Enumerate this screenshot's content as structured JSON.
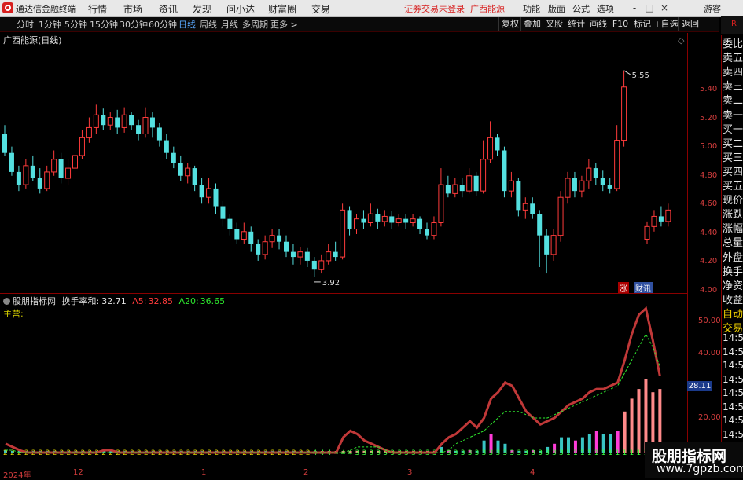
{
  "app": {
    "name": "通达信金融终端"
  },
  "menu": [
    "行情",
    "市场",
    "资讯",
    "发现",
    "问小达",
    "财富圈",
    "交易"
  ],
  "status_text": "证券交易未登录",
  "stock_name_top": "广西能源",
  "right_menu": [
    "功能",
    "版面",
    "公式",
    "选项"
  ],
  "guest_label": "游客",
  "window_controls": [
    "-",
    "□",
    "×"
  ],
  "period_tabs": [
    "分时",
    "1分钟",
    "5分钟",
    "15分钟",
    "30分钟",
    "60分钟",
    "日线",
    "周线",
    "月线",
    "多周期",
    "更多 >"
  ],
  "active_tab": "日线",
  "toolbar_buttons": [
    "复权",
    "叠加",
    "叉股",
    "统计",
    "画线",
    "F10",
    "标记",
    "+自选",
    "返回"
  ],
  "chart_title": "广西能源(日线)",
  "price_axis": [
    "5.40",
    "5.20",
    "5.00",
    "4.80",
    "4.60",
    "4.40",
    "4.20",
    "4.00"
  ],
  "high_label": "5.55",
  "low_label": "3.92",
  "badges": {
    "zhang": "涨",
    "caixun": "财讯"
  },
  "indicator": {
    "name": "股朋指标网",
    "turnover_label": "换手率和:",
    "turnover_value": "32.71",
    "a5_label": "A5:",
    "a5_value": "32.85",
    "a20_label": "A20:",
    "a20_value": "36.65",
    "main_label": "主营:",
    "axis": [
      "50.00",
      "40.00",
      "20.00"
    ],
    "current_value": "28.11",
    "colors": {
      "turnover": "#e6e6e6",
      "a5": "#ff3b3b",
      "a20": "#2ee82e",
      "main": "#d6d000"
    }
  },
  "right_panel": [
    "委比",
    "卖五",
    "卖四",
    "卖三",
    "卖二",
    "卖一",
    "买一",
    "买二",
    "买三",
    "买四",
    "买五",
    "现价",
    "涨跌",
    "涨幅",
    "总量",
    "外盘",
    "换手",
    "净资",
    "收益",
    "自动",
    "交易"
  ],
  "right_panel_times": [
    "14:5",
    "14:5",
    "14:5",
    "14:5",
    "14:5",
    "14:5",
    "14:5",
    "14:5"
  ],
  "r_mark": "R",
  "date_axis": [
    "2024年",
    "12",
    "1",
    "2",
    "3",
    "4"
  ],
  "watermark": {
    "title": "股朋指标网",
    "url": "www.7gpzb.com"
  },
  "chart_data": {
    "type": "candlestick",
    "title": "广西能源(日线)",
    "ylim": [
      3.85,
      5.6
    ],
    "candles": [
      [
        5.05,
        4.9,
        5.12,
        4.88
      ],
      [
        4.9,
        4.75,
        4.95,
        4.72
      ],
      [
        4.75,
        4.65,
        4.8,
        4.6
      ],
      [
        4.65,
        4.8,
        4.85,
        4.62
      ],
      [
        4.8,
        4.7,
        4.88,
        4.68
      ],
      [
        4.7,
        4.62,
        4.78,
        4.58
      ],
      [
        4.62,
        4.75,
        4.8,
        4.6
      ],
      [
        4.75,
        4.85,
        4.92,
        4.72
      ],
      [
        4.85,
        4.7,
        4.9,
        4.66
      ],
      [
        4.7,
        4.78,
        4.85,
        4.65
      ],
      [
        4.78,
        4.88,
        4.95,
        4.75
      ],
      [
        4.88,
        5.02,
        5.08,
        4.85
      ],
      [
        5.02,
        5.1,
        5.18,
        4.98
      ],
      [
        5.1,
        5.2,
        5.28,
        5.05
      ],
      [
        5.2,
        5.12,
        5.25,
        5.08
      ],
      [
        5.12,
        5.18,
        5.22,
        5.08
      ],
      [
        5.18,
        5.1,
        5.24,
        5.05
      ],
      [
        5.1,
        5.2,
        5.26,
        5.06
      ],
      [
        5.2,
        5.12,
        5.22,
        5.08
      ],
      [
        5.12,
        5.05,
        5.16,
        5.0
      ],
      [
        5.05,
        5.18,
        5.26,
        5.02
      ],
      [
        5.18,
        5.1,
        5.22,
        5.02
      ],
      [
        5.1,
        5.0,
        5.14,
        4.95
      ],
      [
        5.0,
        4.9,
        5.05,
        4.85
      ],
      [
        4.9,
        4.82,
        4.95,
        4.78
      ],
      [
        4.82,
        4.72,
        4.88,
        4.68
      ],
      [
        4.72,
        4.78,
        4.82,
        4.66
      ],
      [
        4.78,
        4.65,
        4.8,
        4.6
      ],
      [
        4.65,
        4.55,
        4.7,
        4.5
      ],
      [
        4.55,
        4.62,
        4.7,
        4.5
      ],
      [
        4.62,
        4.48,
        4.66,
        4.42
      ],
      [
        4.48,
        4.38,
        4.52,
        4.32
      ],
      [
        4.38,
        4.3,
        4.42,
        4.25
      ],
      [
        4.3,
        4.22,
        4.35,
        4.18
      ],
      [
        4.22,
        4.28,
        4.35,
        4.18
      ],
      [
        4.28,
        4.18,
        4.32,
        4.12
      ],
      [
        4.18,
        4.1,
        4.22,
        4.05
      ],
      [
        4.1,
        4.2,
        4.25,
        4.06
      ],
      [
        4.2,
        4.25,
        4.3,
        4.15
      ],
      [
        4.25,
        4.2,
        4.3,
        4.14
      ],
      [
        4.2,
        4.12,
        4.25,
        4.08
      ],
      [
        4.12,
        4.08,
        4.18,
        4.02
      ],
      [
        4.08,
        4.12,
        4.16,
        4.02
      ],
      [
        4.12,
        4.05,
        4.15,
        4.0
      ],
      [
        4.05,
        3.98,
        4.08,
        3.92
      ],
      [
        3.98,
        4.05,
        4.1,
        3.95
      ],
      [
        4.05,
        4.12,
        4.18,
        4.02
      ],
      [
        4.12,
        4.08,
        4.2,
        4.05
      ],
      [
        4.08,
        4.45,
        4.5,
        4.06
      ],
      [
        4.45,
        4.3,
        4.48,
        4.25
      ],
      [
        4.3,
        4.38,
        4.42,
        4.26
      ],
      [
        4.38,
        4.35,
        4.45,
        4.3
      ],
      [
        4.35,
        4.42,
        4.5,
        4.32
      ],
      [
        4.42,
        4.36,
        4.46,
        4.3
      ],
      [
        4.36,
        4.4,
        4.45,
        4.32
      ],
      [
        4.4,
        4.35,
        4.44,
        4.3
      ],
      [
        4.35,
        4.38,
        4.42,
        4.32
      ],
      [
        4.38,
        4.35,
        4.42,
        4.3
      ],
      [
        4.35,
        4.38,
        4.42,
        4.32
      ],
      [
        4.38,
        4.3,
        4.4,
        4.26
      ],
      [
        4.3,
        4.25,
        4.35,
        4.22
      ],
      [
        4.25,
        4.35,
        4.4,
        4.22
      ],
      [
        4.35,
        4.65,
        4.78,
        4.32
      ],
      [
        4.65,
        4.58,
        4.72,
        4.55
      ],
      [
        4.58,
        4.65,
        4.7,
        4.55
      ],
      [
        4.65,
        4.6,
        4.7,
        4.55
      ],
      [
        4.6,
        4.72,
        4.78,
        4.58
      ],
      [
        4.72,
        4.6,
        4.75,
        4.56
      ],
      [
        4.6,
        4.85,
        5.0,
        4.58
      ],
      [
        4.85,
        5.02,
        5.15,
        4.82
      ],
      [
        5.02,
        4.92,
        5.05,
        4.88
      ],
      [
        4.92,
        4.6,
        4.95,
        4.55
      ],
      [
        4.6,
        4.68,
        4.75,
        4.55
      ],
      [
        4.68,
        4.45,
        4.7,
        4.4
      ],
      [
        4.45,
        4.5,
        4.55,
        4.38
      ],
      [
        4.5,
        4.42,
        4.55,
        4.38
      ],
      [
        4.42,
        4.25,
        4.45,
        4.0
      ],
      [
        4.25,
        4.1,
        4.3,
        3.95
      ],
      [
        4.1,
        4.25,
        4.3,
        4.05
      ],
      [
        4.25,
        4.55,
        4.6,
        4.2
      ],
      [
        4.55,
        4.7,
        4.75,
        4.5
      ],
      [
        4.7,
        4.6,
        4.75,
        4.55
      ],
      [
        4.6,
        4.68,
        4.72,
        4.55
      ],
      [
        4.68,
        4.78,
        4.85,
        4.62
      ],
      [
        4.78,
        4.7,
        4.82,
        4.65
      ],
      [
        4.7,
        4.65,
        4.76,
        4.6
      ],
      [
        4.65,
        4.62,
        4.7,
        4.58
      ],
      [
        4.62,
        5.0,
        5.12,
        4.6
      ],
      [
        5.0,
        5.42,
        5.55,
        4.95
      ],
      [
        4.22,
        4.32,
        4.36,
        4.18
      ],
      [
        4.32,
        4.4,
        4.45,
        4.28
      ],
      [
        4.4,
        4.36,
        4.48,
        4.32
      ],
      [
        4.36,
        4.45,
        4.5,
        4.32
      ]
    ],
    "turnover": [
      10,
      9,
      8,
      7,
      6,
      5,
      4,
      4,
      5,
      6,
      6,
      7,
      8,
      9,
      9,
      8,
      7,
      7,
      6,
      6,
      5,
      5,
      4,
      4,
      4,
      3,
      3,
      3,
      2,
      2,
      2,
      2,
      3,
      3,
      3,
      3,
      3,
      3,
      3,
      3,
      3,
      3,
      3,
      3,
      3,
      4,
      5,
      6,
      9,
      7,
      7,
      7,
      6,
      6,
      6,
      5,
      5,
      5,
      5,
      5,
      5,
      5,
      11,
      10,
      9,
      9,
      10,
      9,
      13,
      15,
      13,
      12,
      10,
      9,
      9,
      10,
      9,
      11,
      12,
      14,
      14,
      13,
      14,
      15,
      16,
      15,
      15,
      16,
      22,
      26,
      29,
      32,
      28,
      29
    ],
    "a5": [
      12,
      11,
      10,
      9,
      8,
      7,
      6,
      5,
      5,
      5,
      6,
      7,
      8,
      9,
      10,
      10,
      9,
      8,
      7,
      6,
      5,
      5,
      4,
      4,
      4,
      3,
      3,
      3,
      3,
      3,
      3,
      2,
      2,
      3,
      3,
      3,
      3,
      3,
      3,
      3,
      3,
      3,
      3,
      3,
      4,
      4,
      6,
      8,
      14,
      16,
      15,
      13,
      12,
      11,
      10,
      8,
      7,
      6,
      6,
      5,
      5,
      6,
      12,
      14,
      15,
      17,
      19,
      17,
      20,
      26,
      28,
      31,
      30,
      26,
      22,
      20,
      18,
      19,
      20,
      22,
      24,
      25,
      26,
      28,
      29,
      29,
      30,
      31,
      38,
      46,
      52,
      54,
      44,
      33
    ],
    "a20": [
      10,
      10,
      9,
      9,
      8,
      8,
      7,
      7,
      6,
      6,
      6,
      7,
      7,
      8,
      8,
      8,
      8,
      7,
      7,
      7,
      6,
      6,
      5,
      5,
      5,
      4,
      4,
      4,
      4,
      4,
      4,
      4,
      4,
      4,
      4,
      4,
      4,
      4,
      4,
      4,
      4,
      4,
      4,
      4,
      5,
      5,
      6,
      7,
      9,
      10,
      11,
      11,
      11,
      11,
      10,
      9,
      9,
      8,
      8,
      8,
      7,
      7,
      9,
      10,
      12,
      13,
      14,
      15,
      16,
      18,
      20,
      22,
      22,
      22,
      21,
      20,
      20,
      20,
      21,
      22,
      23,
      24,
      25,
      26,
      27,
      28,
      29,
      30,
      34,
      38,
      42,
      46,
      42,
      36
    ]
  }
}
